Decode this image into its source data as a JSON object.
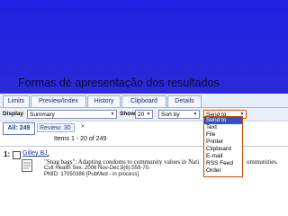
{
  "slide": {
    "title": "Formas de apresentação dos resultados"
  },
  "tabs": [
    "Limits",
    "Preview/Index",
    "History",
    "Clipboard",
    "Details"
  ],
  "display_bar": {
    "display_label": "Display",
    "display_value": "Summary",
    "show_label": "Show",
    "show_value": "20",
    "sort_value": "Sort by",
    "send_value": "Send to"
  },
  "results": {
    "all_tab": "All: 249",
    "review_tab": "Review: 30",
    "close_symbol": "✕",
    "items_line": "Items 1 - 20 of 249",
    "row_number": "1:",
    "author": "Gilley BJ,",
    "title": "\"Snag bags\": Adapting condoms to community values in Nati",
    "title_tail": "ommunities.",
    "journal": "Cult Health Sex. 2006 Nov-Dec;8(6):559-70.",
    "pmid": "PMID: 17050386 [PubMed - in process]"
  },
  "send_to_menu": {
    "options": [
      "Send to",
      "Text",
      "File",
      "Printer",
      "Clipboard",
      "E-mail",
      "RSS Feed",
      "Order"
    ],
    "selected": "Send to"
  },
  "colors": {
    "slide_bg": "#2a2ad0",
    "menu_highlight": "#2d55c8",
    "menu_border": "#c44a00"
  }
}
